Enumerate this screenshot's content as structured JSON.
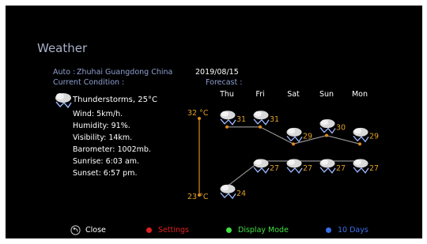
{
  "header": {
    "title": "Weather",
    "location_label": "Auto :",
    "location": "Zhuhai   Guangdong  China",
    "date": "2019/08/15",
    "current_label": "Current Condition :",
    "forecast_label": "Forecast :"
  },
  "current": {
    "condition": "Thunderstorms, 25°C",
    "icon": "thunderstorm-icon",
    "details": [
      "Wind: 5km/h.",
      "Humidity: 91%.",
      "Visibility: 14km.",
      "Barometer: 1002mb.",
      "Sunrise: 6:03 am.",
      "Sunset: 6:57 pm."
    ]
  },
  "forecast": {
    "scale_max": "32 °C",
    "scale_min": "23 °C",
    "range": [
      23,
      32
    ],
    "days": [
      {
        "day": "Thu",
        "high": 31,
        "low": 24,
        "icon": "thunderstorm-icon"
      },
      {
        "day": "Fri",
        "high": 31,
        "low": 27,
        "icon": "thunderstorm-icon"
      },
      {
        "day": "Sat",
        "high": 29,
        "low": 27,
        "icon": "thunderstorm-icon"
      },
      {
        "day": "Sun",
        "high": 30,
        "low": 27,
        "icon": "thunderstorm-icon"
      },
      {
        "day": "Mon",
        "high": 29,
        "low": 27,
        "icon": "thunderstorm-icon"
      }
    ]
  },
  "colors": {
    "background": "#000000",
    "graph_line": "#9a9a9a",
    "graph_point": "#e08a1e",
    "temperature_text": "#e0a028",
    "label_blue": "#8f9fd0",
    "red_key": "#e02020",
    "green_key": "#40e040",
    "blue_key": "#3a6ee8"
  },
  "footer": {
    "close_label": "Close",
    "close_icon": "back-arrow-icon",
    "settings_label": "Settings",
    "display_mode_label": "Display Mode",
    "ten_days_label": "10 Days"
  }
}
